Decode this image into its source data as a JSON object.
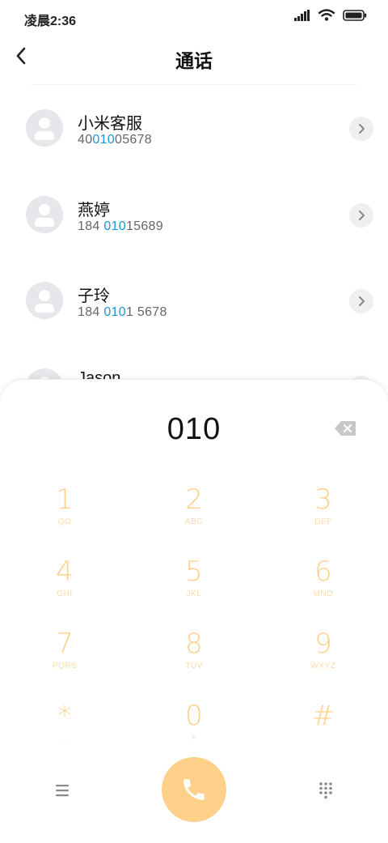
{
  "status_bar": {
    "time": "凌晨2:36"
  },
  "header": {
    "title": "通话"
  },
  "contacts": [
    {
      "name": "小米客服",
      "number_pre": "40",
      "number_match": "010",
      "number_post": "05678"
    },
    {
      "name": "燕婷",
      "number_pre": "184 ",
      "number_match": "010",
      "number_post": "15689"
    },
    {
      "name": "子玲",
      "number_pre": "184 ",
      "number_match": "010",
      "number_post": "1 5678"
    },
    {
      "name": "Jason",
      "number_pre": "",
      "number_match": "",
      "number_post": ""
    }
  ],
  "dialpad": {
    "input": "010",
    "keys": [
      {
        "digit": "1",
        "letters": "QO"
      },
      {
        "digit": "2",
        "letters": "ABC"
      },
      {
        "digit": "3",
        "letters": "DEF"
      },
      {
        "digit": "4",
        "letters": "GHI"
      },
      {
        "digit": "5",
        "letters": "JKL"
      },
      {
        "digit": "6",
        "letters": "MNO"
      },
      {
        "digit": "7",
        "letters": "PQRS"
      },
      {
        "digit": "8",
        "letters": "TUV"
      },
      {
        "digit": "9",
        "letters": "WXYZ"
      },
      {
        "digit": "*",
        "letters": ","
      },
      {
        "digit": "0",
        "letters": "+"
      },
      {
        "digit": "#",
        "letters": ""
      }
    ]
  },
  "icons": {
    "back": "chevron-left-icon",
    "detail": "chevron-right-icon",
    "backspace": "backspace-icon",
    "menu": "menu-icon",
    "call": "phone-icon",
    "keypad": "keypad-grid-icon"
  },
  "colors": {
    "accent": "#ffd08a",
    "match_highlight": "#1e96d6",
    "avatar_bg": "#e6e7ea"
  }
}
